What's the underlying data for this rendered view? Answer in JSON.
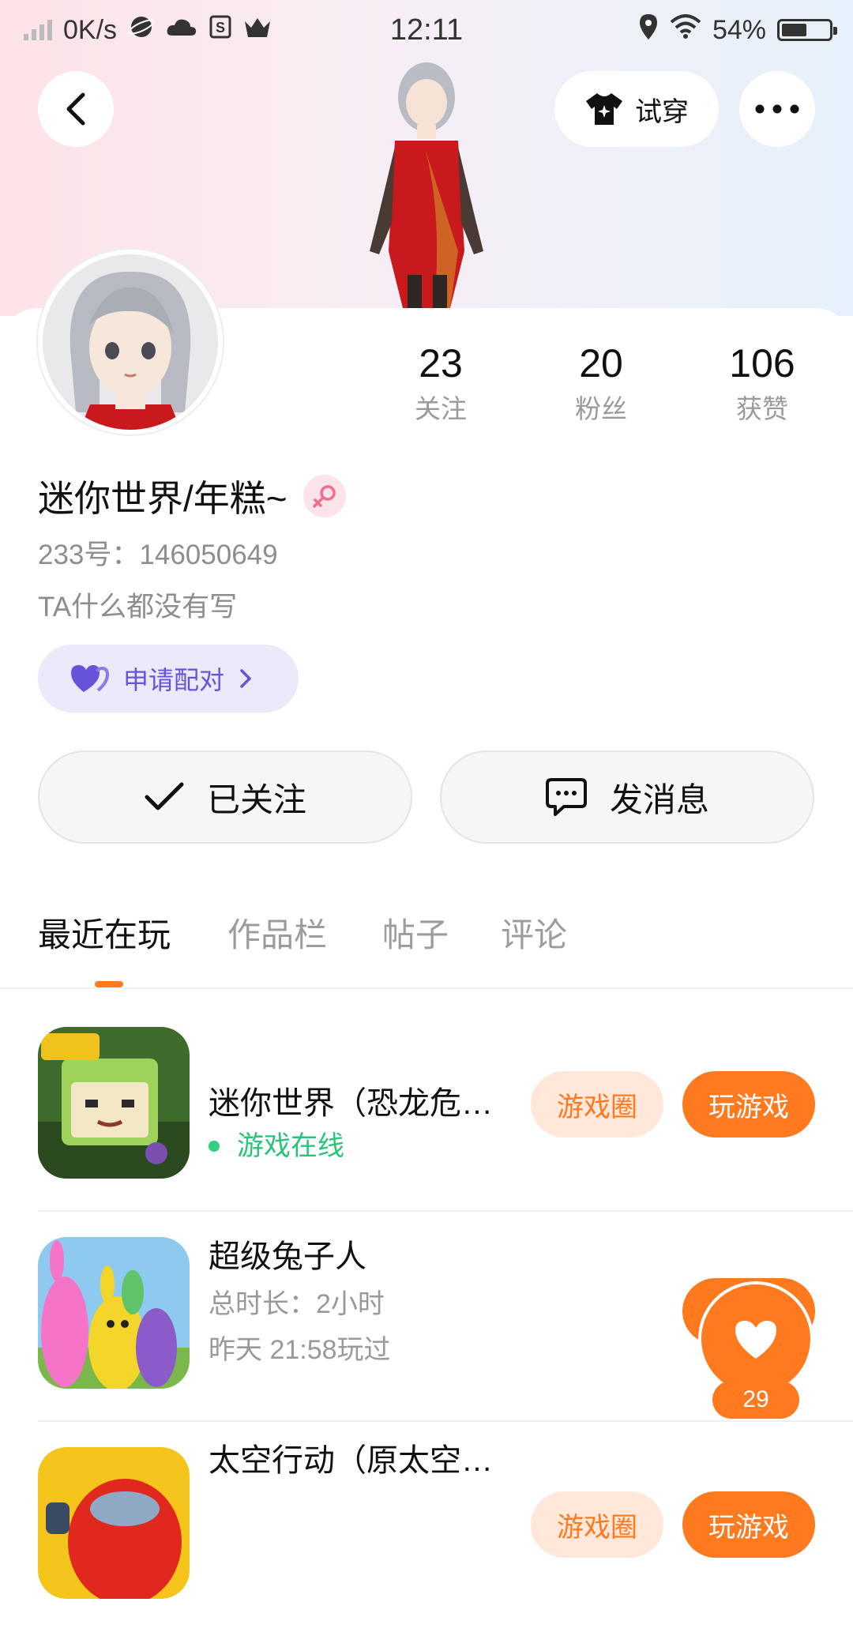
{
  "status_bar": {
    "net_speed": "0K/s",
    "time": "12:11",
    "battery_pct": "54%",
    "battery_level": 0.54
  },
  "top_bar": {
    "try_on_label": "试穿"
  },
  "profile": {
    "name": "迷你世界/年糕~",
    "gender": "female",
    "uid": "233号：146050649",
    "bio": "TA什么都没有写",
    "pair_label": "申请配对",
    "stats": [
      {
        "value": "23",
        "label": "关注"
      },
      {
        "value": "20",
        "label": "粉丝"
      },
      {
        "value": "106",
        "label": "获赞"
      }
    ]
  },
  "actions": {
    "follow_label": "已关注",
    "message_label": "发消息"
  },
  "tabs": [
    {
      "label": "最近在玩",
      "active": true
    },
    {
      "label": "作品栏",
      "active": false
    },
    {
      "label": "帖子",
      "active": false
    },
    {
      "label": "评论",
      "active": false
    }
  ],
  "games": [
    {
      "title": "迷你世界（恐龙危…",
      "status": "游戏在线",
      "circle_label": "游戏圈",
      "play_label": "玩游戏"
    },
    {
      "title": "超级兔子人",
      "duration": "总时长：2小时",
      "last_played": "昨天 21:58玩过"
    },
    {
      "title": "太空行动（原太空…",
      "circle_label": "游戏圈",
      "play_label": "玩游戏"
    }
  ],
  "like_fab": {
    "count": "29"
  },
  "colors": {
    "accent": "#ff7a1e",
    "accent_light": "#ffe8da",
    "online": "#2bc37a",
    "pair_text": "#6553d9",
    "pair_bg": "#ece9fb"
  }
}
